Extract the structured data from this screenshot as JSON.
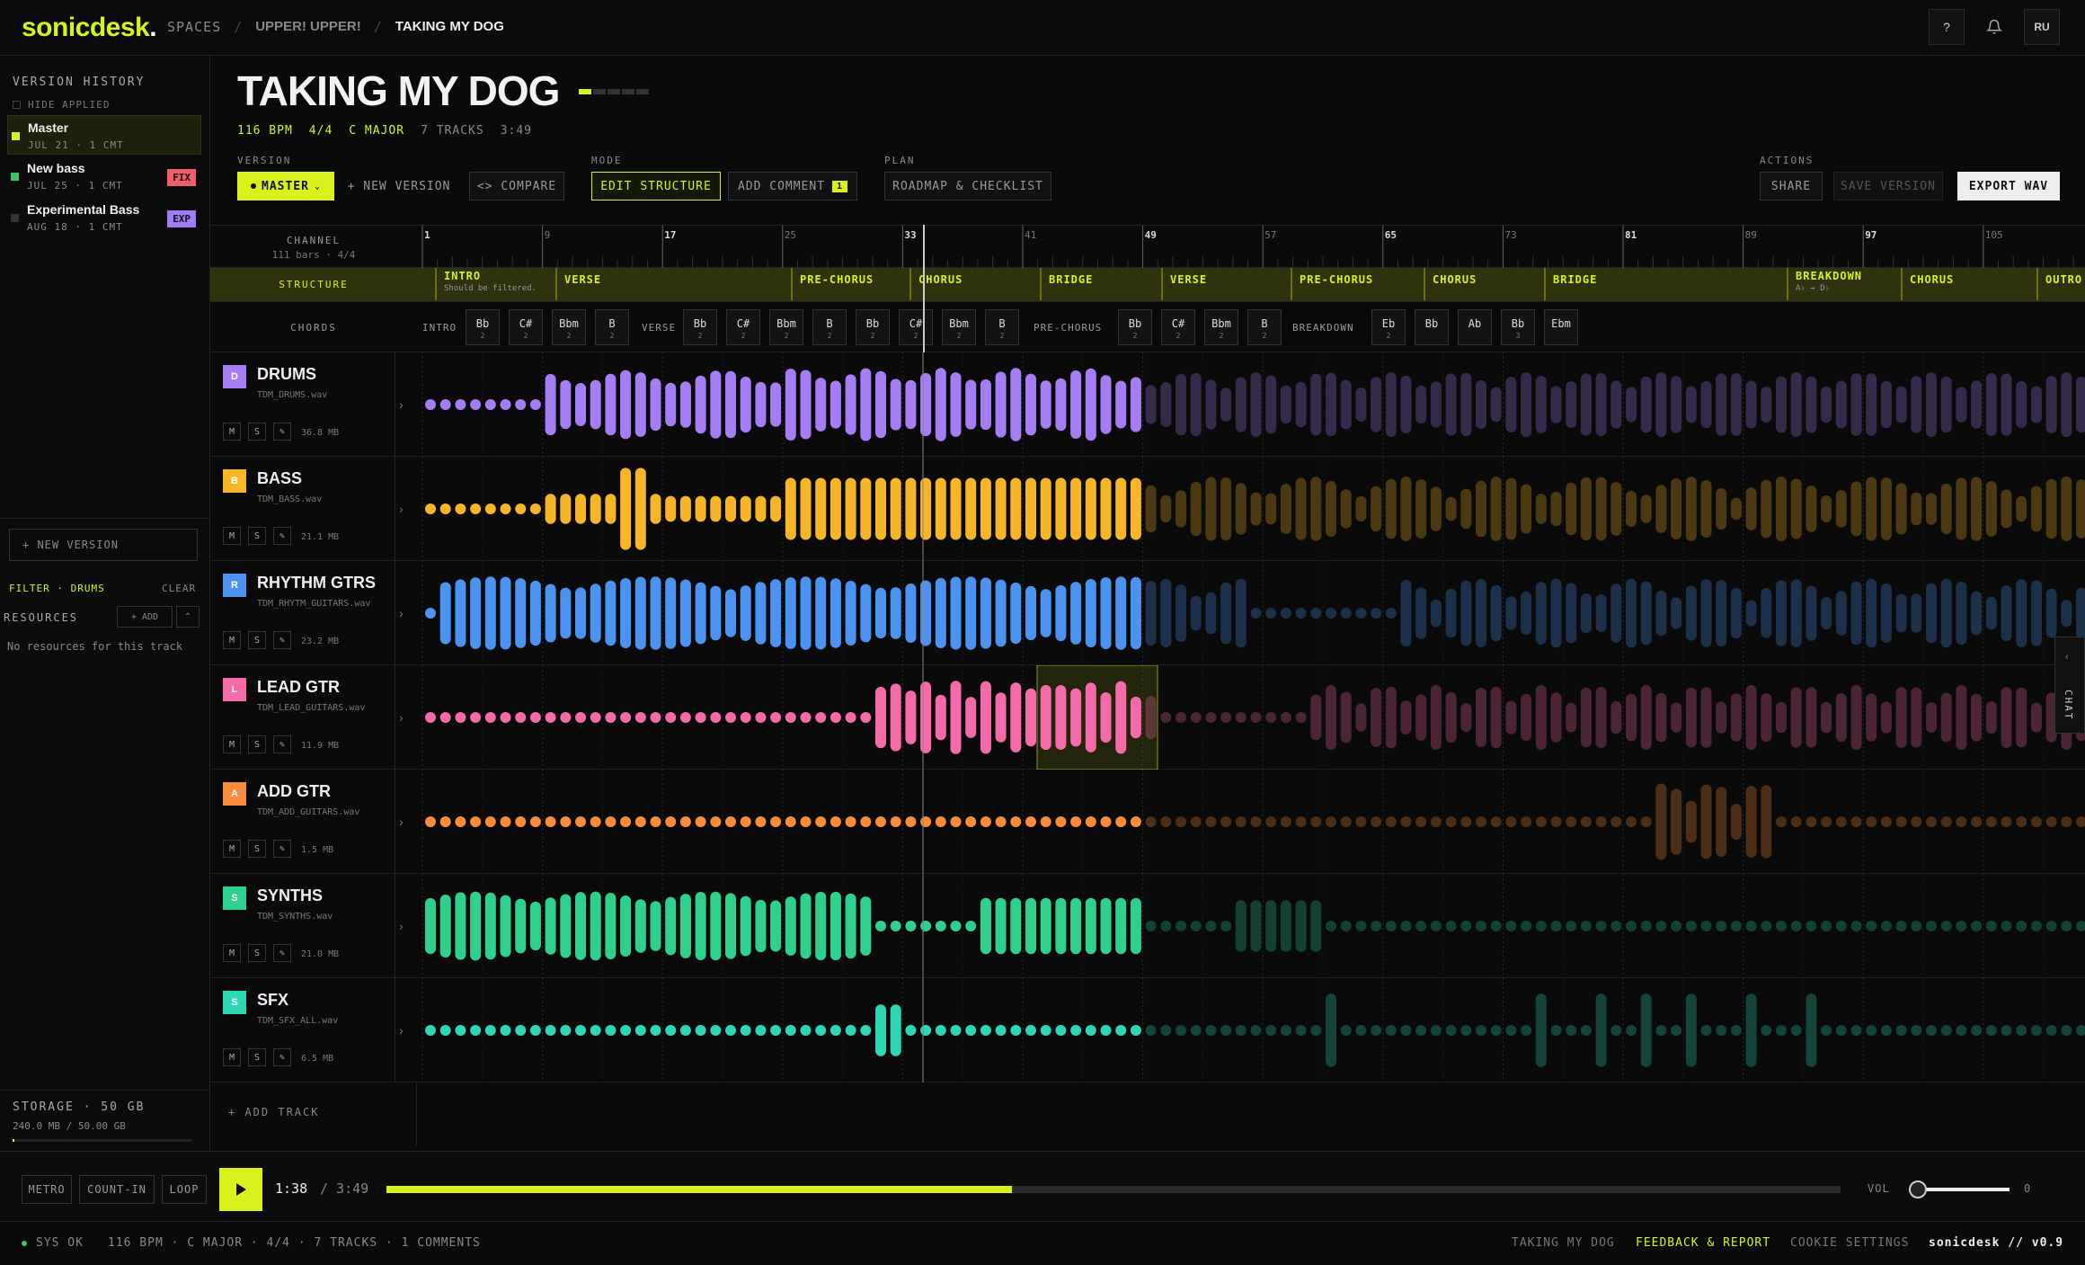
{
  "app": {
    "logo_text": "sonicdesk",
    "logo_dot": ".",
    "accent": "#d9f21b"
  },
  "breadcrumb": {
    "spaces": "SPACES",
    "project": "UPPER! UPPER!",
    "song": "TAKING MY DOG"
  },
  "topbar": {
    "help": "?",
    "avatar": "RU"
  },
  "sidebar": {
    "title": "VERSION HISTORY",
    "hide_applied": "HIDE APPLIED",
    "versions": [
      {
        "name": "Master",
        "meta": "JUL 21 · 1 CMT",
        "color": "#d9f21b",
        "tag": ""
      },
      {
        "name": "New bass",
        "meta": "JUL 25 · 1 CMT",
        "color": "#3cc464",
        "tag": "FIX",
        "tag_color": "#ef5e6b"
      },
      {
        "name": "Experimental Bass",
        "meta": "AUG 18 · 1 CMT",
        "color": "#333333",
        "tag": "EXP",
        "tag_color": "#a07df2"
      }
    ],
    "new_version": "+ NEW VERSION",
    "filter": "FILTER · DRUMS",
    "clear": "CLEAR",
    "resources": "RESOURCES",
    "add": "+ ADD",
    "no_resources": "No resources for this track",
    "storage_title": "STORAGE · 50 GB",
    "storage_used": "240.0 MB / 50.00 GB",
    "storage_fraction": 0.005
  },
  "song": {
    "title": "TAKING MY DOG",
    "bpm": "116 BPM",
    "sig": "4/4",
    "key": "C MAJOR",
    "tracks": "7 TRACKS",
    "length": "3:49"
  },
  "toolbar": {
    "version_label": "VERSION",
    "master": "MASTER",
    "new_version": "+ NEW VERSION",
    "compare": "<> COMPARE",
    "mode_label": "MODE",
    "edit_structure": "EDIT STRUCTURE",
    "add_comment": "ADD COMMENT",
    "comment_count": "1",
    "plan_label": "PLAN",
    "roadmap": "ROADMAP & CHECKLIST",
    "actions_label": "ACTIONS",
    "share": "SHARE",
    "save_version": "SAVE VERSION",
    "export": "EXPORT WAV"
  },
  "channel": {
    "label": "CHANNEL",
    "info": "111 bars · 4/4"
  },
  "ruler": [
    {
      "bar": "1",
      "major": true
    },
    {
      "bar": "9",
      "major": false
    },
    {
      "bar": "17",
      "major": true
    },
    {
      "bar": "25",
      "major": false
    },
    {
      "bar": "33",
      "major": true
    },
    {
      "bar": "41",
      "major": false
    },
    {
      "bar": "49",
      "major": true
    },
    {
      "bar": "57",
      "major": false
    },
    {
      "bar": "65",
      "major": true
    },
    {
      "bar": "73",
      "major": false
    },
    {
      "bar": "81",
      "major": true
    },
    {
      "bar": "89",
      "major": false
    },
    {
      "bar": "97",
      "major": true
    },
    {
      "bar": "105",
      "major": false
    }
  ],
  "structure": {
    "label": "STRUCTURE",
    "sections": [
      {
        "name": "INTRO",
        "sub": "Should be filtered..."
      },
      {
        "name": "VERSE",
        "sub": ""
      },
      {
        "name": "PRE-CHORUS",
        "sub": ""
      },
      {
        "name": "CHORUS",
        "sub": ""
      },
      {
        "name": "BRIDGE",
        "sub": ""
      },
      {
        "name": "VERSE",
        "sub": ""
      },
      {
        "name": "PRE-CHORUS",
        "sub": ""
      },
      {
        "name": "CHORUS",
        "sub": ""
      },
      {
        "name": "BRIDGE",
        "sub": ""
      },
      {
        "name": "BREAKDOWN",
        "sub": "A♭ → D♭"
      },
      {
        "name": "CHORUS",
        "sub": ""
      },
      {
        "name": "OUTRO",
        "sub": ""
      }
    ]
  },
  "chords": {
    "label": "CHORDS",
    "intro": "INTRO",
    "verse": "VERSE",
    "prechorus": "PRE-CHORUS",
    "breakdown": "BREAKDOWN",
    "intro_chords": [
      {
        "c": "Bb",
        "n": "2"
      },
      {
        "c": "C#",
        "n": "2"
      },
      {
        "c": "Bbm",
        "n": "2"
      },
      {
        "c": "B",
        "n": "2"
      }
    ],
    "verse_chords": [
      {
        "c": "Bb",
        "n": "2"
      },
      {
        "c": "C#",
        "n": "2"
      },
      {
        "c": "Bbm",
        "n": "2"
      },
      {
        "c": "B",
        "n": "2"
      },
      {
        "c": "Bb",
        "n": "2"
      },
      {
        "c": "C#",
        "n": "2"
      },
      {
        "c": "Bbm",
        "n": "2"
      },
      {
        "c": "B",
        "n": "2"
      }
    ],
    "pre_chords": [
      {
        "c": "Bb",
        "n": "2"
      },
      {
        "c": "C#",
        "n": "2"
      },
      {
        "c": "Bbm",
        "n": "2"
      },
      {
        "c": "B",
        "n": "2"
      }
    ],
    "break_chords": [
      {
        "c": "Eb",
        "n": "2"
      },
      {
        "c": "Bb",
        "n": ""
      },
      {
        "c": "Ab",
        "n": ""
      },
      {
        "c": "Bb",
        "n": "3"
      },
      {
        "c": "Ebm",
        "n": ""
      }
    ]
  },
  "tracks": [
    {
      "letter": "D",
      "name": "DRUMS",
      "file": "TDM_DRUMS.wav",
      "size": "36.8 MB",
      "color": "#a67df5"
    },
    {
      "letter": "B",
      "name": "BASS",
      "file": "TDM_BASS.wav",
      "size": "21.1 MB",
      "color": "#f7b52a"
    },
    {
      "letter": "R",
      "name": "RHYTHM GTRS",
      "file": "TDM_RHYTM_GUITARS.wav",
      "size": "23.2 MB",
      "color": "#4c92f0"
    },
    {
      "letter": "L",
      "name": "LEAD GTR",
      "file": "TDM_LEAD_GUITARS.wav",
      "size": "11.9 MB",
      "color": "#f56aa8"
    },
    {
      "letter": "A",
      "name": "ADD GTR",
      "file": "TDM_ADD_GUITARS.wav",
      "size": "1.5 MB",
      "color": "#f88b3c"
    },
    {
      "letter": "S",
      "name": "SYNTHS",
      "file": "TDM_SYNTHS.wav",
      "size": "21.0 MB",
      "color": "#2fd08e"
    },
    {
      "letter": "S",
      "name": "SFX",
      "file": "TDM_SFX_ALL.wav",
      "size": "6.5 MB",
      "color": "#2fd6b4"
    }
  ],
  "track_buttons": {
    "mute": "M",
    "solo": "S"
  },
  "add_track": "+ ADD TRACK",
  "chat": "CHAT",
  "transport": {
    "metro": "METRO",
    "countin": "COUNT-IN",
    "loop": "LOOP",
    "time": "1:38",
    "total": "/ 3:49",
    "progress": 0.43,
    "vol_label": "VOL",
    "vol_value": "0"
  },
  "status": {
    "sys": "SYS OK",
    "info": "116 BPM · C MAJOR · 4/4 · 7 TRACKS · 1 COMMENTS",
    "song": "TAKING MY DOG",
    "feedback": "FEEDBACK & REPORT",
    "cookies": "COOKIE SETTINGS",
    "brand": "sonicdesk // v0.9"
  }
}
